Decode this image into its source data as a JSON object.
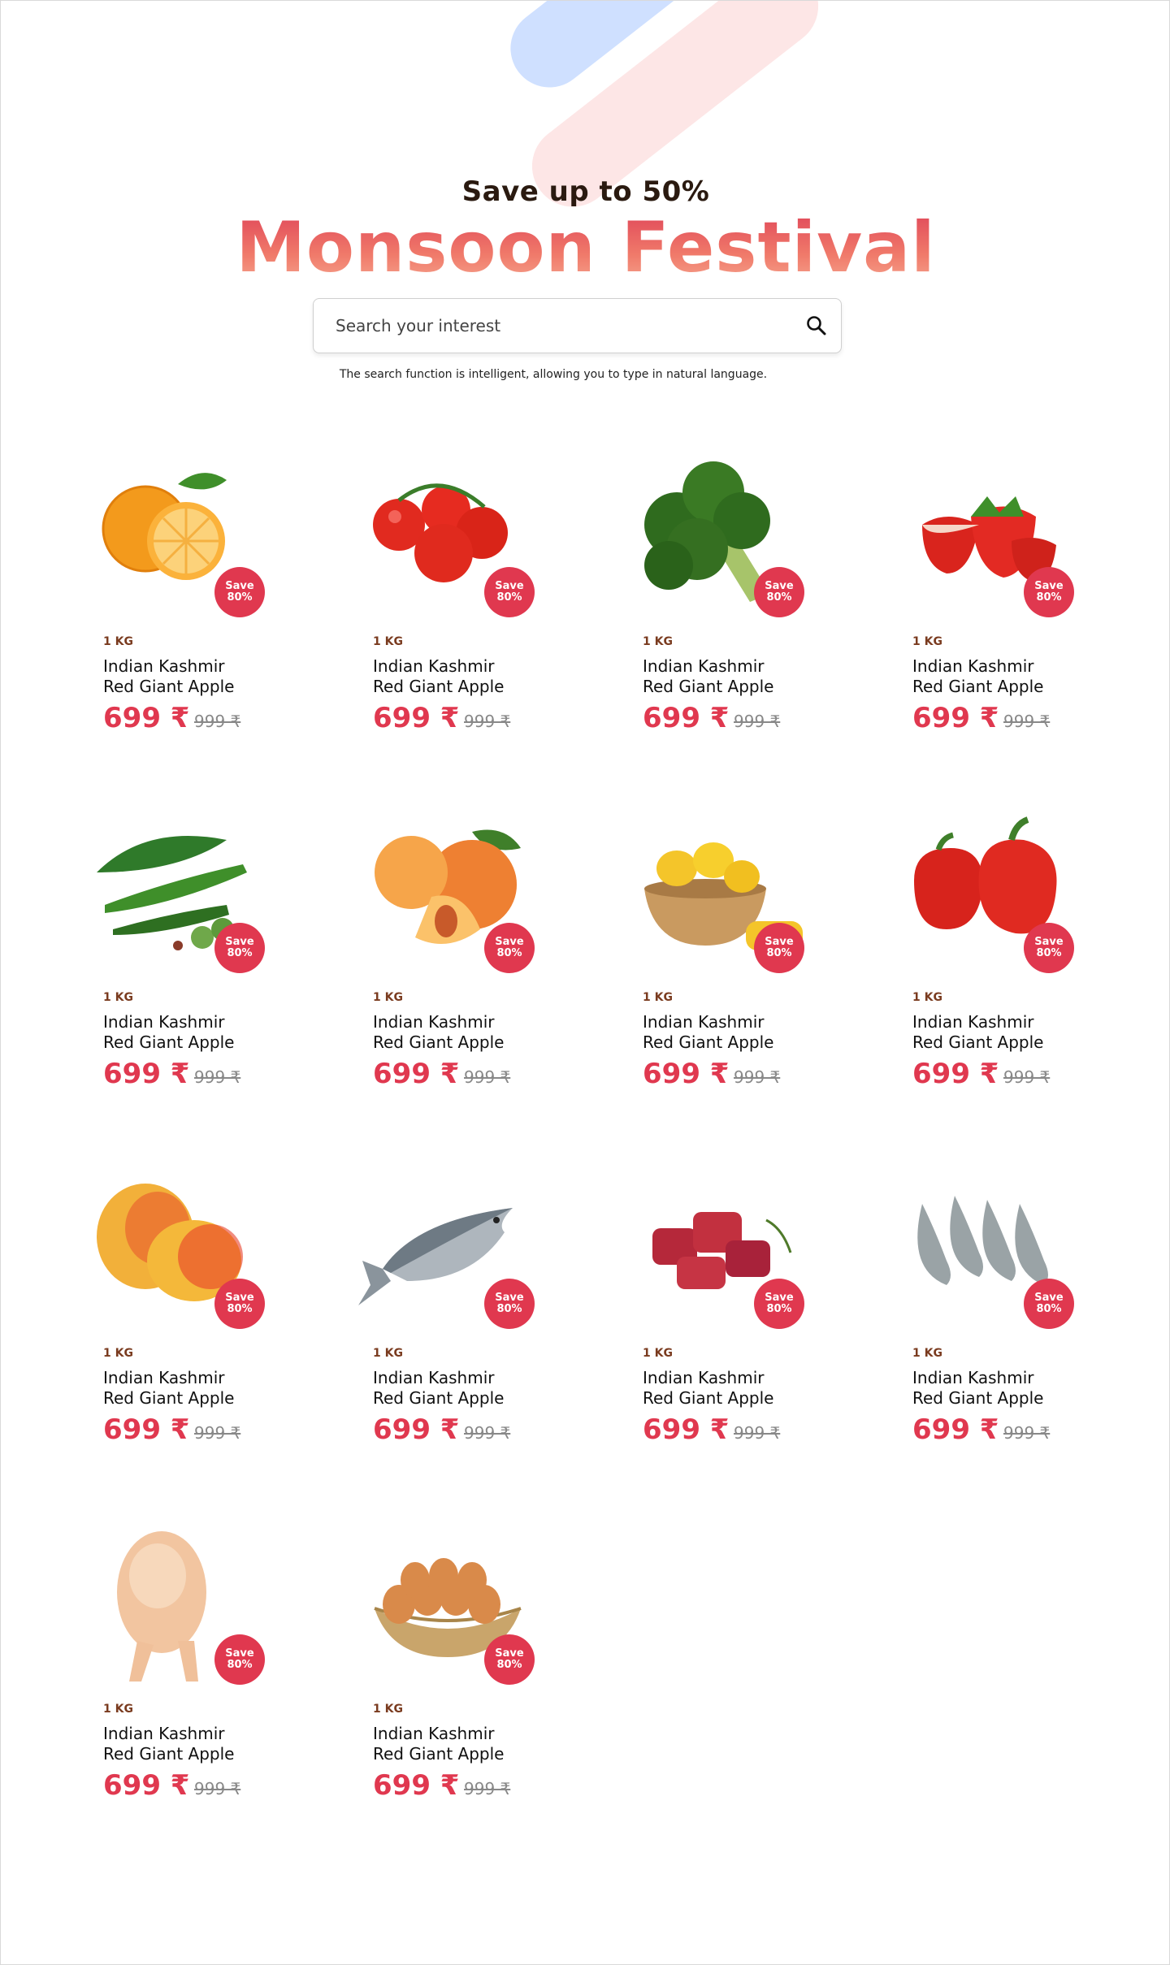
{
  "hero": {
    "subtitle": "Save up to 50%",
    "title": "Monsoon Festival"
  },
  "search": {
    "placeholder": "Search your interest",
    "hint": "The search function is intelligent, allowing you to type in natural language."
  },
  "products": [
    {
      "icon": "orange-icon",
      "badge_line1": "Save",
      "badge_line2": "80%",
      "qty": "1 KG",
      "name_line1": "Indian Kashmir",
      "name_line2": "Red Giant Apple",
      "price": "699 ₹",
      "old_price": "999 ₹"
    },
    {
      "icon": "tomato-icon",
      "badge_line1": "Save",
      "badge_line2": "80%",
      "qty": "1 KG",
      "name_line1": "Indian Kashmir",
      "name_line2": "Red Giant Apple",
      "price": "699 ₹",
      "old_price": "999 ₹"
    },
    {
      "icon": "broccoli-icon",
      "badge_line1": "Save",
      "badge_line2": "80%",
      "qty": "1 KG",
      "name_line1": "Indian Kashmir",
      "name_line2": "Red Giant Apple",
      "price": "699 ₹",
      "old_price": "999 ₹"
    },
    {
      "icon": "strawberry-icon",
      "badge_line1": "Save",
      "badge_line2": "80%",
      "qty": "1 KG",
      "name_line1": "Indian Kashmir",
      "name_line2": "Red Giant Apple",
      "price": "699 ₹",
      "old_price": "999 ₹"
    },
    {
      "icon": "okra-icon",
      "badge_line1": "Save",
      "badge_line2": "80%",
      "qty": "1 KG",
      "name_line1": "Indian Kashmir",
      "name_line2": "Red Giant Apple",
      "price": "699 ₹",
      "old_price": "999 ₹"
    },
    {
      "icon": "peach-icon",
      "badge_line1": "Save",
      "badge_line2": "80%",
      "qty": "1 KG",
      "name_line1": "Indian Kashmir",
      "name_line2": "Red Giant Apple",
      "price": "699 ₹",
      "old_price": "999 ₹"
    },
    {
      "icon": "jackfruit-icon",
      "badge_line1": "Save",
      "badge_line2": "80%",
      "qty": "1 KG",
      "name_line1": "Indian Kashmir",
      "name_line2": "Red Giant Apple",
      "price": "699 ₹",
      "old_price": "999 ₹"
    },
    {
      "icon": "bell-pepper-icon",
      "badge_line1": "Save",
      "badge_line2": "80%",
      "qty": "1 KG",
      "name_line1": "Indian Kashmir",
      "name_line2": "Red Giant Apple",
      "price": "699 ₹",
      "old_price": "999 ₹"
    },
    {
      "icon": "mango-icon",
      "badge_line1": "Save",
      "badge_line2": "80%",
      "qty": "1 KG",
      "name_line1": "Indian Kashmir",
      "name_line2": "Red Giant Apple",
      "price": "699 ₹",
      "old_price": "999 ₹"
    },
    {
      "icon": "fish-icon",
      "badge_line1": "Save",
      "badge_line2": "80%",
      "qty": "1 KG",
      "name_line1": "Indian Kashmir",
      "name_line2": "Red Giant Apple",
      "price": "699 ₹",
      "old_price": "999 ₹"
    },
    {
      "icon": "meat-icon",
      "badge_line1": "Save",
      "badge_line2": "80%",
      "qty": "1 KG",
      "name_line1": "Indian Kashmir",
      "name_line2": "Red Giant Apple",
      "price": "699 ₹",
      "old_price": "999 ₹"
    },
    {
      "icon": "shrimp-icon",
      "badge_line1": "Save",
      "badge_line2": "80%",
      "qty": "1 KG",
      "name_line1": "Indian Kashmir",
      "name_line2": "Red Giant Apple",
      "price": "699 ₹",
      "old_price": "999 ₹"
    },
    {
      "icon": "chicken-icon",
      "badge_line1": "Save",
      "badge_line2": "80%",
      "qty": "1 KG",
      "name_line1": "Indian Kashmir",
      "name_line2": "Red Giant Apple",
      "price": "699 ₹",
      "old_price": "999 ₹"
    },
    {
      "icon": "eggs-icon",
      "badge_line1": "Save",
      "badge_line2": "80%",
      "qty": "1 KG",
      "name_line1": "Indian Kashmir",
      "name_line2": "Red Giant Apple",
      "price": "699 ₹",
      "old_price": "999 ₹"
    }
  ],
  "colors": {
    "accent": "#e0384f",
    "qty": "#7a3b1f",
    "title_dark": "#2a1a10"
  }
}
